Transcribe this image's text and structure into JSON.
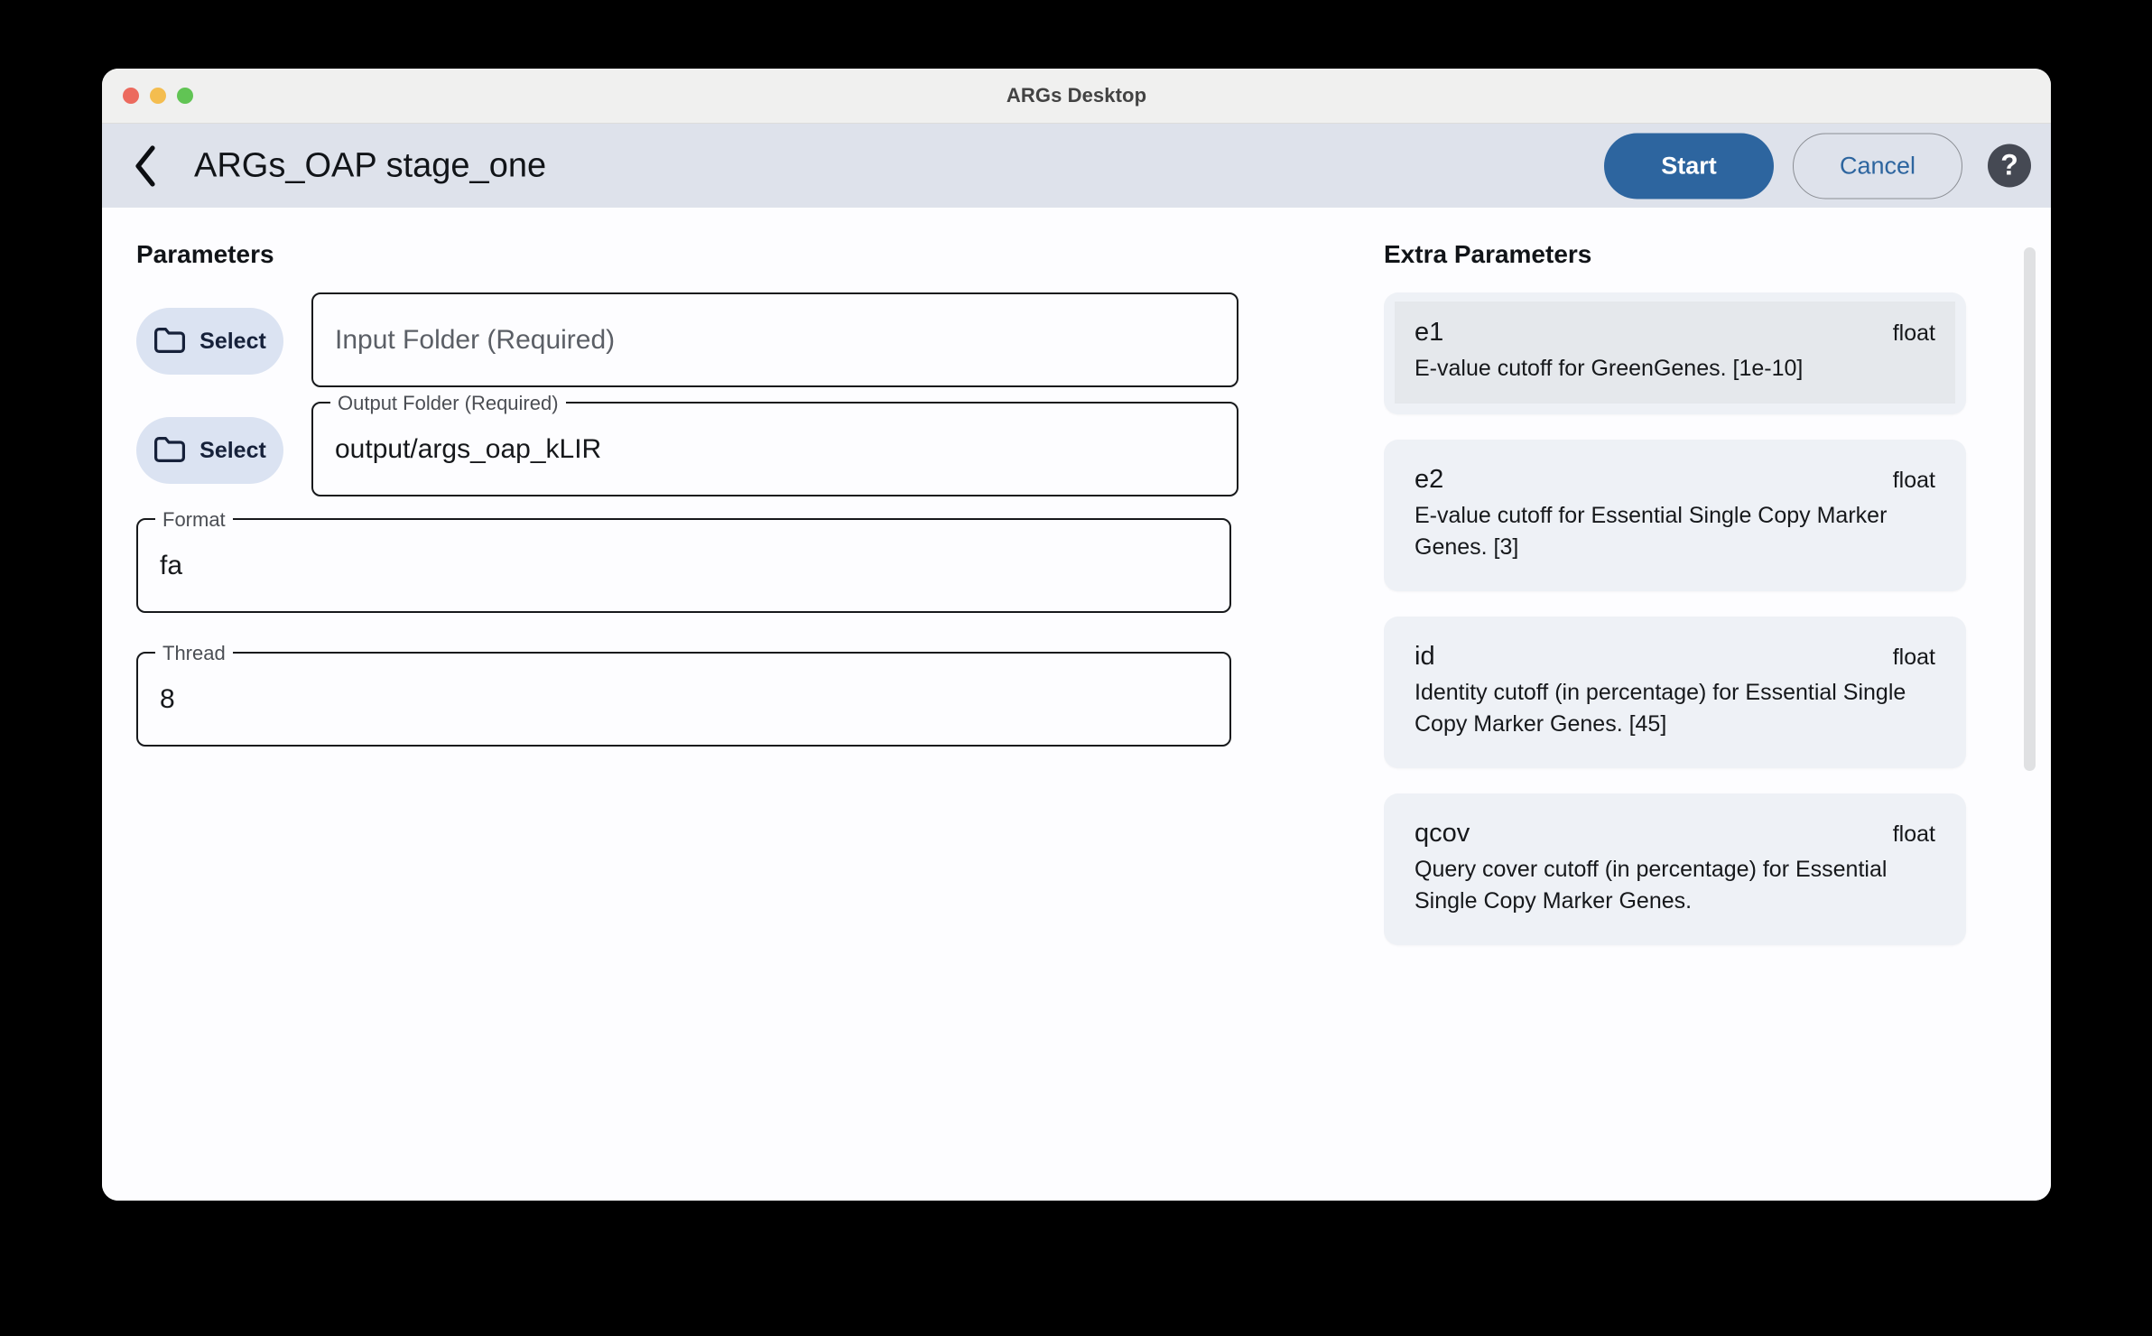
{
  "window": {
    "title": "ARGs Desktop",
    "traffic_lights": [
      "close-red",
      "minimize-yellow",
      "maximize-green"
    ]
  },
  "toolbar": {
    "back_icon": "chevron-left-icon",
    "page_title": "ARGs_OAP stage_one",
    "start_label": "Start",
    "cancel_label": "Cancel",
    "help_label": "?"
  },
  "parameters": {
    "heading": "Parameters",
    "input_folder": {
      "select_label": "Select",
      "placeholder": "Input Folder (Required)",
      "value": ""
    },
    "output_folder": {
      "select_label": "Select",
      "legend": "Output Folder (Required)",
      "value": "output/args_oap_kLIR"
    },
    "format": {
      "legend": "Format",
      "value": "fa"
    },
    "thread": {
      "legend": "Thread",
      "value": "8"
    }
  },
  "extra_parameters": {
    "heading": "Extra Parameters",
    "items": [
      {
        "name": "e1",
        "type": "float",
        "description": "E-value cutoff for GreenGenes. [1e-10]",
        "selected": true
      },
      {
        "name": "e2",
        "type": "float",
        "description": "E-value cutoff for Essential Single Copy Marker Genes. [3]",
        "selected": false
      },
      {
        "name": "id",
        "type": "float",
        "description": "Identity cutoff (in percentage) for Essential Single Copy Marker Genes. [45]",
        "selected": false
      },
      {
        "name": "qcov",
        "type": "float",
        "description": "Query cover cutoff (in percentage) for Essential Single Copy Marker Genes.",
        "selected": false
      }
    ]
  },
  "colors": {
    "accent": "#2d659f",
    "toolbar_bg": "#dee2eb",
    "titlebar_bg": "#f0f0ef",
    "card_bg": "#eef1f6",
    "card_selected_bg": "#e5e8ec",
    "select_btn_bg": "#dbe3f2"
  }
}
